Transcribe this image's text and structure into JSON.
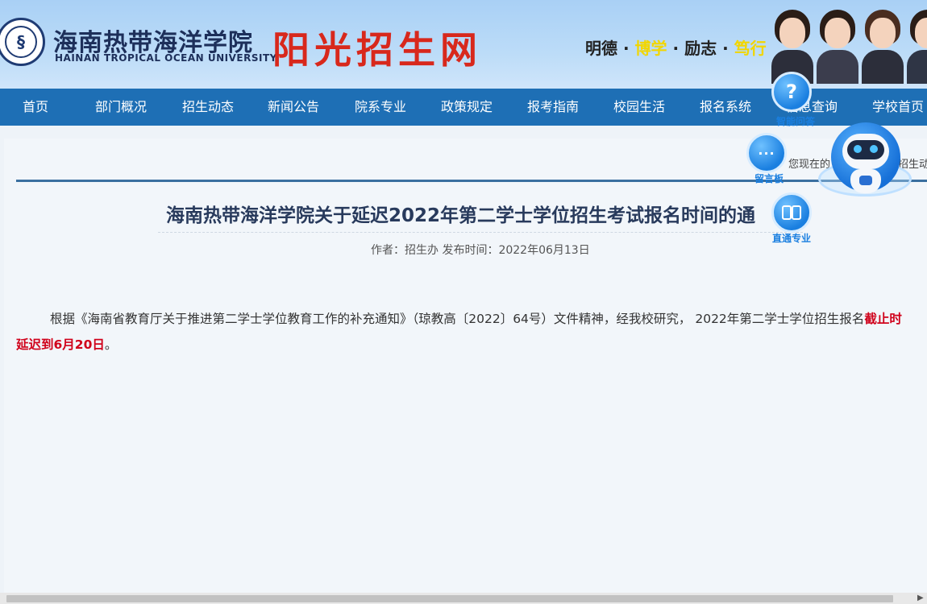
{
  "header": {
    "university_cn": "海南热带海洋学院",
    "university_en": "HAINAN TROPICAL OCEAN UNIVERSITY",
    "site_name": "阳光招生网",
    "motto": {
      "p1": "明德",
      "sep1": "·",
      "p2": "博学",
      "sep2": "·",
      "p3": "励志",
      "sep3": "·",
      "p4": "笃行"
    },
    "colors": {
      "site_name": "#d8281c",
      "motto_accent": "#f2d600"
    }
  },
  "nav": {
    "items": [
      {
        "label": "首页"
      },
      {
        "label": "部门概况"
      },
      {
        "label": "招生动态"
      },
      {
        "label": "新闻公告"
      },
      {
        "label": "院系专业"
      },
      {
        "label": "政策规定"
      },
      {
        "label": "报考指南"
      },
      {
        "label": "校园生活"
      },
      {
        "label": "报名系统"
      },
      {
        "label": "信息查询"
      },
      {
        "label": "学校首页"
      }
    ],
    "color": "#1e6fb5"
  },
  "location": {
    "prefix": "您现在的",
    "tail": "招生动"
  },
  "article": {
    "title": "海南热带海洋学院关于延迟2022年第二学士学位招生考试报名时间的通",
    "meta": "作者：招生办  发布时间：2022年06月13日",
    "line1_text": "根据《海南省教育厅关于推进第二学士学位教育工作的补充通知》（琼教高〔2022〕64号）文件精神，经我校研究， 2022年第二学士学位招生报名",
    "line1_red": "截止时",
    "line2_red": "延迟到6月20日",
    "line2_end": "。"
  },
  "float_tools": {
    "qa": {
      "label": "智能问答",
      "icon": "question-icon",
      "glyph": "?"
    },
    "board": {
      "label": "留言板",
      "icon": "chat-bubble-icon",
      "glyph": "···"
    },
    "major": {
      "label": "直通专业",
      "icon": "book-icon"
    }
  }
}
